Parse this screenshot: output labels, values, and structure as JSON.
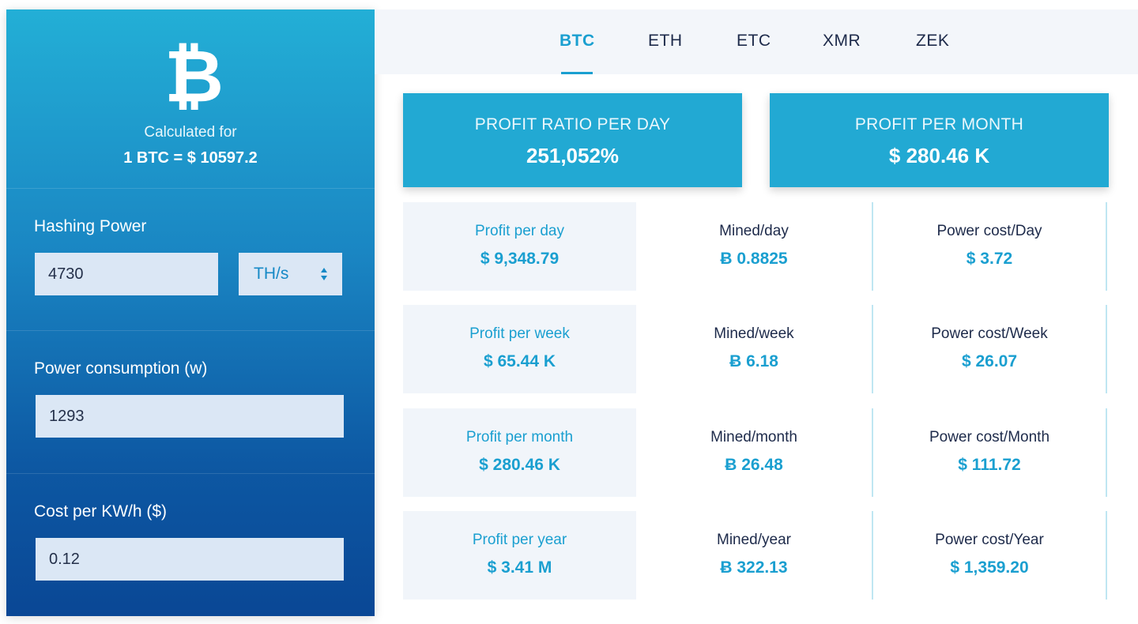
{
  "sidebar": {
    "coin_symbol": "₿",
    "calc_label": "Calculated for",
    "calc_rate": "1 BTC = $ 10597.2",
    "hashing": {
      "label": "Hashing Power",
      "value": "4730",
      "unit": "TH/s"
    },
    "power": {
      "label": "Power consumption (w)",
      "value": "1293"
    },
    "cost": {
      "label": "Cost per KW/h ($)",
      "value": "0.12"
    }
  },
  "tabs": [
    {
      "label": "BTC",
      "active": true
    },
    {
      "label": "ETH",
      "active": false
    },
    {
      "label": "ETC",
      "active": false
    },
    {
      "label": "XMR",
      "active": false
    },
    {
      "label": "ZEK",
      "active": false
    }
  ],
  "summary": {
    "ratio": {
      "label": "PROFIT RATIO PER DAY",
      "value": "251,052%"
    },
    "month": {
      "label": "PROFIT PER MONTH",
      "value": "$ 280.46 K"
    }
  },
  "stats": [
    {
      "profit_label": "Profit per day",
      "profit_value": "$ 9,348.79",
      "mined_label": "Mined/day",
      "mined_value": "Ƀ 0.8825",
      "power_label": "Power cost/Day",
      "power_value": "$ 3.72"
    },
    {
      "profit_label": "Profit per week",
      "profit_value": "$ 65.44 K",
      "mined_label": "Mined/week",
      "mined_value": "Ƀ 6.18",
      "power_label": "Power cost/Week",
      "power_value": "$ 26.07"
    },
    {
      "profit_label": "Profit per month",
      "profit_value": "$ 280.46 K",
      "mined_label": "Mined/month",
      "mined_value": "Ƀ 26.48",
      "power_label": "Power cost/Month",
      "power_value": "$ 111.72"
    },
    {
      "profit_label": "Profit per year",
      "profit_value": "$ 3.41 M",
      "mined_label": "Mined/year",
      "mined_value": "Ƀ 322.13",
      "power_label": "Power cost/Year",
      "power_value": "$ 1,359.20"
    }
  ],
  "colors": {
    "accent": "#1a9fd0",
    "summary_card": "#22a9d3",
    "panel_top": "#23afd6",
    "panel_bottom": "#0a4795",
    "text_dark": "#1d2a4a"
  },
  "icons": {
    "coin": "bitcoin-icon",
    "select_arrows": "updown-arrows-icon"
  }
}
